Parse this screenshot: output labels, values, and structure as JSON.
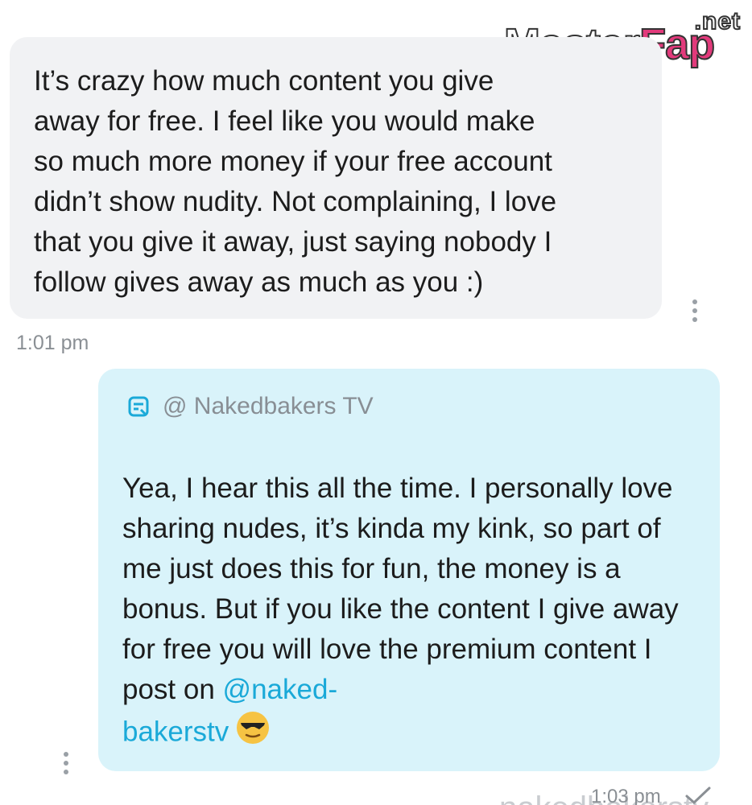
{
  "incoming_message": {
    "text": "It’s crazy how much content you give\naway for free. I feel like you would make\nso much more money if your free account\ndidn’t show nudity. Not complaining, I love\nthat you give it away, just saying nobody I\nfollow gives away as much as you :)",
    "time": "1:01 pm"
  },
  "outgoing_message": {
    "reply_label": "@ Nakedbakers TV",
    "text_main": "Yea, I hear this all the time. I personally love sharing nudes, it’s kinda my kink, so part of me just does this for fun, the money is a bonus. But if you like the content I give away for free you will love the premium content I post on ",
    "mention_part1": "@naked-",
    "mention_part2": "bakerstv",
    "emoji": "😎",
    "time": "1:03 pm"
  },
  "watermark": {
    "brand_part1": "Master",
    "brand_part2": "Fap",
    "suffix": ".net"
  },
  "partial_bottom_text": "nakedbakerstv",
  "colors": {
    "incoming_bubble": "#f1f2f4",
    "outgoing_bubble": "#d9f3fa",
    "mention": "#1aa9d8",
    "brand_pink": "#e23a7b"
  }
}
